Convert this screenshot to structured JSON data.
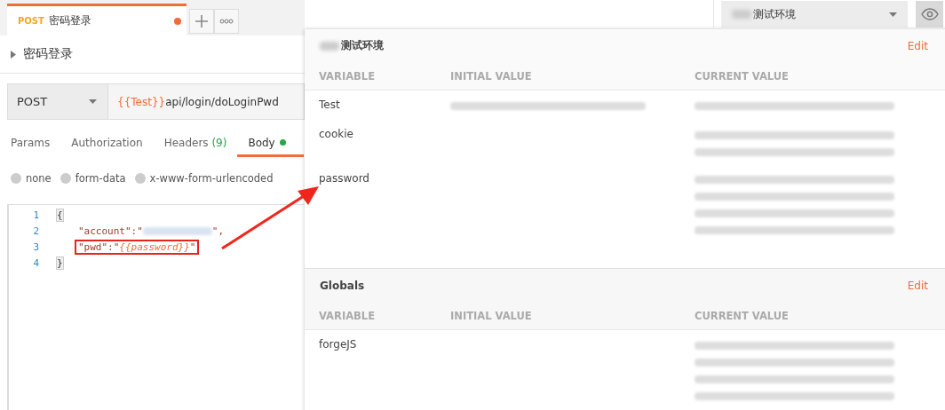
{
  "request_tab": {
    "method": "POST",
    "name": "密码登录",
    "unsaved": true
  },
  "title": "密码登录",
  "request": {
    "method": "POST",
    "url_variable": "{{Test}}",
    "url_path": "api/login/doLoginPwd"
  },
  "tabs": [
    {
      "label": "Params",
      "selected": false
    },
    {
      "label": "Authorization",
      "selected": false
    },
    {
      "label": "Headers",
      "count": "(9)",
      "selected": false
    },
    {
      "label": "Body",
      "has_content": true,
      "selected": true
    }
  ],
  "body_types": [
    {
      "label": "none",
      "selected": false
    },
    {
      "label": "form-data",
      "selected": false
    },
    {
      "label": "x-www-form-urlencoded",
      "selected": false
    }
  ],
  "code_lines": [
    {
      "number": "1",
      "highlighted": false,
      "tokens": [
        {
          "kind": "punct",
          "text": "{"
        }
      ]
    },
    {
      "number": "2",
      "highlighted": false,
      "tokens": [
        {
          "kind": "string",
          "text": "\"account\":\""
        },
        {
          "kind": "blurred"
        },
        {
          "kind": "string",
          "text": "\","
        }
      ]
    },
    {
      "number": "3",
      "highlighted": true,
      "tokens": [
        {
          "kind": "string",
          "text": "\"pwd\":\""
        },
        {
          "kind": "variable",
          "text": "{{password}}"
        },
        {
          "kind": "string",
          "text": "\""
        }
      ]
    },
    {
      "number": "4",
      "highlighted": false,
      "tokens": [
        {
          "kind": "punct",
          "text": "}"
        }
      ]
    }
  ],
  "environment_selector": {
    "name": "测试环境"
  },
  "environment_popup": {
    "sections": [
      {
        "kind": "environment",
        "title": "测试环境",
        "action": "Edit",
        "columns": [
          "VARIABLE",
          "INITIAL VALUE",
          "CURRENT VALUE"
        ],
        "rows": [
          {
            "variable": "Test"
          },
          {
            "variable": "cookie"
          },
          {
            "variable": "password"
          }
        ]
      },
      {
        "kind": "globals",
        "title": "Globals",
        "action": "Edit",
        "columns": [
          "VARIABLE",
          "INITIAL VALUE",
          "CURRENT VALUE"
        ],
        "rows": [
          {
            "variable": "forgeJS"
          }
        ]
      }
    ]
  }
}
